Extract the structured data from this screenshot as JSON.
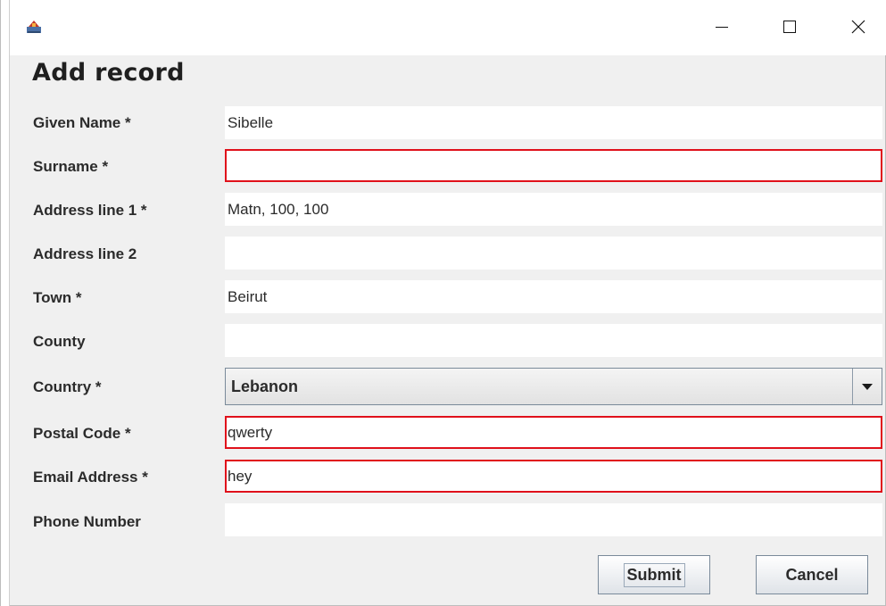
{
  "window": {
    "title": "",
    "icons": {
      "app": "java-app-icon",
      "minimize": "minimize-icon",
      "maximize": "maximize-icon",
      "close": "close-icon"
    }
  },
  "form": {
    "heading": "Add record",
    "fields": {
      "given_name": {
        "label": "Given Name *",
        "value": "Sibelle"
      },
      "surname": {
        "label": "Surname *",
        "value": ""
      },
      "address1": {
        "label": "Address line 1 *",
        "value": "Matn, 100, 100"
      },
      "address2": {
        "label": "Address line 2",
        "value": ""
      },
      "town": {
        "label": "Town *",
        "value": "Beirut"
      },
      "county": {
        "label": "County",
        "value": ""
      },
      "country": {
        "label": "Country *",
        "value": "Lebanon"
      },
      "postal_code": {
        "label": "Postal Code *",
        "value": "qwerty"
      },
      "email": {
        "label": "Email Address *",
        "value": "hey"
      },
      "phone": {
        "label": "Phone Number",
        "value": ""
      }
    },
    "error_color": "#e0111b"
  },
  "buttons": {
    "submit": "Submit",
    "cancel": "Cancel"
  }
}
